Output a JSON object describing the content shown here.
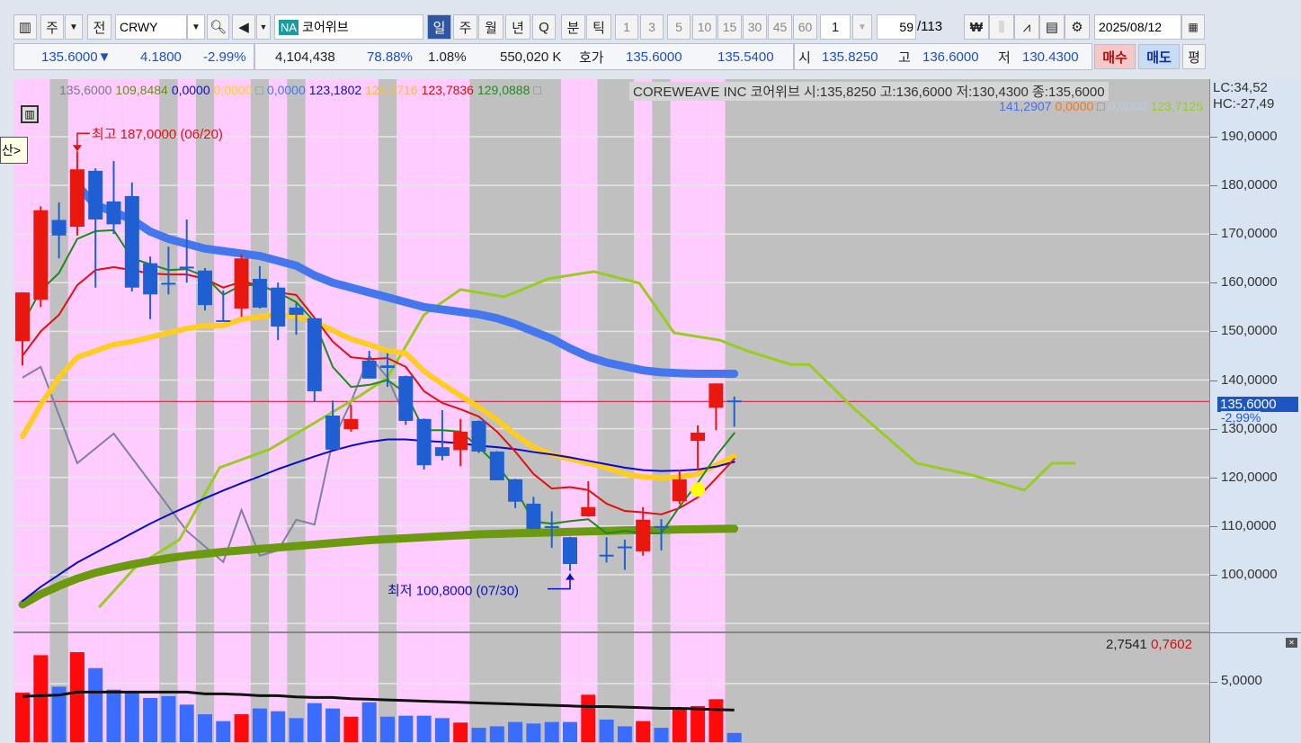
{
  "toolbar": {
    "market": "주",
    "market_all": "전",
    "symbol": "CRWY",
    "name_badge": "NA",
    "name": "코어위브",
    "periods": [
      "일",
      "주",
      "월",
      "년",
      "Q",
      "분",
      "틱"
    ],
    "selected_period": "일",
    "intervals": [
      "1",
      "3",
      "5",
      "10",
      "15",
      "30",
      "45",
      "60"
    ],
    "interval_custom": "1",
    "count": "59",
    "count_total": "/113",
    "date": "2025/08/12",
    "icons": [
      "currency-won-icon",
      "add-candle-icon",
      "add-line-icon",
      "save-icon",
      "gear-icon"
    ]
  },
  "quote": {
    "price": "135.6000▼",
    "change": "4.1800",
    "change_pct": "-2.99%",
    "volume": "4,104,438",
    "ratio": "78.88%",
    "turnover": "1.08%",
    "amount": "550,020 K",
    "hoga_label": "호가",
    "ask": "135.6000",
    "bid": "135.5400",
    "open_label": "시",
    "open": "135.8250",
    "high_label": "고",
    "high": "136.6000",
    "low_label": "저",
    "low": "130.4300",
    "buy": "매수",
    "sell": "매도",
    "avg": "평"
  },
  "legend": {
    "row1": [
      {
        "t": "135,6000",
        "c": "#7a7a90"
      },
      {
        "t": "109,8484",
        "c": "#6b8e23"
      },
      {
        "t": "0,0000",
        "c": "#1010b0"
      },
      {
        "t": "0,0000",
        "c": "#ffd21e"
      },
      {
        "t": "□",
        "c": "#888"
      },
      {
        "t": "0,0000",
        "c": "#4477ee"
      },
      {
        "t": "123,1802",
        "c": "#1010b0"
      },
      {
        "t": "124,3716",
        "c": "#ffb84d"
      },
      {
        "t": "123,7836",
        "c": "#d01010"
      },
      {
        "t": "129,0888",
        "c": "#228822"
      },
      {
        "t": "□",
        "c": "#888"
      }
    ],
    "title": "COREWEAVE INC  코어위브 시:135,8250 고:136,6000 저:130,4300 종:135,6000",
    "row2": [
      {
        "t": "141,2907",
        "c": "#4a72e0"
      },
      {
        "t": "0,0000",
        "c": "#ee7722"
      },
      {
        "t": "□",
        "c": "#888"
      },
      {
        "t": "0,0000",
        "c": "#b8cce8"
      },
      {
        "t": "123,7125",
        "c": "#99cc33"
      }
    ],
    "lc": "LC:34,52",
    "hc": "HC:-27,49",
    "tooltip": "산>",
    "volume_ma": "2,7541",
    "volume_last": "0,7602"
  },
  "axis": {
    "price_labels": [
      "190,0000",
      "180,0000",
      "170,0000",
      "160,0000",
      "150,0000",
      "140,0000",
      "130,0000",
      "120,0000",
      "110,0000",
      "100,0000"
    ],
    "current_price": "135,6000",
    "current_pct": "-2,99%",
    "volume_labels": [
      "5,0000"
    ]
  },
  "chart_data": {
    "type": "candlestick",
    "title": "COREWEAVE INC 코어위브",
    "ylim": [
      88,
      201
    ],
    "annotations": {
      "high": "최고 187,0000 (06/20)",
      "low": "최저 100,8000 (07/30)",
      "high_index": 4,
      "low_index": 31,
      "high_value": 187,
      "low_value": 100.8
    },
    "current_price": 135.6,
    "gray_bars": [
      3,
      9,
      11,
      14,
      16,
      21,
      26,
      27,
      28,
      29,
      30,
      33,
      34,
      36,
      40
    ],
    "ohlc": [
      [
        148,
        158,
        143,
        158
      ],
      [
        156.5,
        175.7,
        155,
        174.9
      ],
      [
        172.9,
        176.5,
        165,
        169.7
      ],
      [
        171.5,
        187,
        169.7,
        183.3
      ],
      [
        183,
        183.5,
        159,
        173
      ],
      [
        176.7,
        185,
        170,
        172
      ],
      [
        177.8,
        180.6,
        158.2,
        159
      ],
      [
        164,
        165.4,
        152.5,
        157.6
      ],
      [
        160,
        167.4,
        157.6,
        159.6
      ],
      [
        163.3,
        173,
        160,
        163
      ],
      [
        162.5,
        163,
        154.3,
        155.4
      ],
      [
        152.3,
        158.4,
        152.1,
        152.2
      ],
      [
        154.7,
        165.8,
        153,
        165
      ],
      [
        160.8,
        163.4,
        154.7,
        154.9
      ],
      [
        159,
        160,
        148.2,
        151
      ],
      [
        154.9,
        155.8,
        149.3,
        153.4
      ],
      [
        152.7,
        152.9,
        135.5,
        137.7
      ],
      [
        132.7,
        135.8,
        125.7,
        125.7
      ],
      [
        129.9,
        134.9,
        129.4,
        132
      ],
      [
        144,
        146,
        140.3,
        140.3
      ],
      [
        143,
        145.5,
        138.6,
        142.5
      ],
      [
        140.8,
        140.9,
        130.8,
        131.6
      ],
      [
        132,
        132.1,
        121.6,
        122.5
      ],
      [
        126.2,
        133.8,
        123.5,
        124.4
      ],
      [
        125.6,
        132,
        122.3,
        129.4
      ],
      [
        131.6,
        131.7,
        125,
        125.3
      ],
      [
        125.3,
        125.4,
        119.4,
        119.4
      ],
      [
        119.6,
        119.7,
        113.7,
        115
      ],
      [
        114.6,
        116,
        109.4,
        109.4
      ],
      [
        110,
        113,
        105.5,
        109.6
      ],
      [
        107.7,
        107.8,
        100.8,
        102.2
      ],
      [
        112,
        119.2,
        111.9,
        113.9
      ],
      [
        104.1,
        107.7,
        102.5,
        104
      ],
      [
        105.8,
        107.2,
        101,
        105.6
      ],
      [
        104.8,
        113.9,
        103.9,
        111.3
      ],
      [
        110,
        111.4,
        105,
        109.6
      ],
      [
        115.1,
        121.6,
        114.5,
        119.6
      ],
      [
        127.5,
        130.7,
        121.4,
        129.2
      ],
      [
        134.3,
        139.3,
        129.7,
        139.3
      ],
      [
        135.8,
        136.6,
        130.4,
        135.6
      ]
    ],
    "volume": [
      4.1,
      7.21,
      4.6,
      7.46,
      6.14,
      4.35,
      4.1,
      3.66,
      3.81,
      3.11,
      2.31,
      1.74,
      2.31,
      2.79,
      2.56,
      1.99,
      3.23,
      2.79,
      2.11,
      3.31,
      2.11,
      2.19,
      2.19,
      1.99,
      1.62,
      1.19,
      1.31,
      1.67,
      1.54,
      1.67,
      1.67,
      3.93,
      1.87,
      1.31,
      1.74,
      1.19,
      2.81,
      2.99,
      3.56,
      0.76
    ],
    "volume_ma": [
      3.8,
      3.85,
      3.9,
      4.15,
      4.15,
      4.15,
      4.15,
      4.15,
      4.15,
      4.15,
      4.0,
      4.0,
      3.95,
      3.85,
      3.85,
      3.75,
      3.7,
      3.7,
      3.6,
      3.55,
      3.5,
      3.45,
      3.4,
      3.35,
      3.3,
      3.25,
      3.2,
      3.15,
      3.1,
      3.05,
      3.0,
      2.95,
      2.95,
      2.9,
      2.85,
      2.8,
      2.8,
      2.75,
      2.7,
      2.66
    ],
    "series": [
      {
        "name": "ma_long_blue",
        "color": "#4477ee",
        "width": 9,
        "start": 4,
        "values": [
          180,
          176,
          174.5,
          173,
          170.5,
          169,
          168,
          167,
          166.5,
          166,
          165.5,
          164.5,
          163.5,
          161.5,
          160,
          159,
          158,
          157,
          156,
          155,
          154.5,
          154,
          153.5,
          152.7,
          151.5,
          150,
          148.5,
          146.5,
          144.8,
          143.6,
          142.8,
          142,
          141.6,
          141.4,
          141.3,
          141.3,
          141.3
        ]
      },
      {
        "name": "ma_olive",
        "color": "#6b9a10",
        "width": 9,
        "start": 1,
        "values": [
          93.9,
          96,
          97.7,
          99.2,
          100.4,
          101.3,
          102.1,
          102.8,
          103.4,
          103.9,
          104.3,
          104.7,
          105,
          105.3,
          105.6,
          105.9,
          106.2,
          106.5,
          106.8,
          107.1,
          107.3,
          107.5,
          107.7,
          107.9,
          108.1,
          108.3,
          108.4,
          108.5,
          108.6,
          108.7,
          108.8,
          108.9,
          109,
          109.1,
          109.15,
          109.2,
          109.3,
          109.35,
          109.4,
          109.45
        ]
      },
      {
        "name": "ma_yellow",
        "color": "#ffcc22",
        "width": 6,
        "start": 1,
        "values": [
          128.4,
          134.9,
          140.5,
          144.7,
          146,
          147.3,
          147.9,
          148.8,
          149.7,
          150.6,
          151.2,
          151.2,
          152.5,
          153,
          153.4,
          153,
          152,
          150.2,
          148.4,
          147.3,
          146,
          145.5,
          141.8,
          139.2,
          136.8,
          134.4,
          131.8,
          128.8,
          126.2,
          124.7,
          123.8,
          122.9,
          122,
          120.7,
          120.1,
          119.8,
          120.1,
          120.7,
          122.5,
          124.37
        ]
      },
      {
        "name": "ma_navy",
        "color": "#0a0ac8",
        "width": 2,
        "start": 1,
        "values": [
          94.6,
          97.5,
          100,
          102.5,
          104.5,
          106.5,
          108.5,
          110.5,
          112.3,
          114,
          115.7,
          117.3,
          118.8,
          120.2,
          121.7,
          123,
          124.3,
          125.5,
          126.5,
          127.3,
          127.8,
          127.8,
          127.5,
          127.3,
          127,
          126.5,
          126.2,
          125.8,
          125.2,
          124.7,
          124.1,
          123.4,
          122.7,
          122,
          121.5,
          121.3,
          121.4,
          121.6,
          122.2,
          123.18
        ]
      },
      {
        "name": "ma_red",
        "color": "#e01010",
        "width": 2,
        "start": 1,
        "values": [
          145,
          150,
          153.4,
          159.5,
          162.6,
          163.2,
          162.6,
          161.9,
          161.7,
          161.7,
          160.8,
          159,
          160.2,
          159.5,
          158,
          157.5,
          152.8,
          147.9,
          144.7,
          144.3,
          144.5,
          142.7,
          137.7,
          135.3,
          134,
          132.5,
          129.4,
          125.3,
          120.7,
          117.7,
          118,
          117.4,
          114.6,
          113.1,
          112.8,
          112.4,
          113.7,
          115.9,
          119.8,
          123.78
        ]
      },
      {
        "name": "ma_green",
        "color": "#1e8a1e",
        "width": 2,
        "start": 1,
        "values": [
          151.6,
          158.4,
          162,
          169,
          170.6,
          170.8,
          165,
          163.8,
          162.6,
          162.8,
          161.3,
          157.5,
          159.5,
          159.5,
          158,
          156,
          152,
          142.7,
          138.6,
          139,
          140,
          137.3,
          129.7,
          129.7,
          129.4,
          126.2,
          122.5,
          117.7,
          110.9,
          110.5,
          111,
          111.4,
          108.5,
          109,
          108.5,
          108.5,
          114,
          118.9,
          124.4,
          129.09
        ]
      }
    ],
    "leading_span": {
      "color": "#99cc22",
      "points": [
        [
          5.2,
          93.3
        ],
        [
          7.2,
          101.6
        ],
        [
          9.6,
          107.2
        ],
        [
          11.8,
          122
        ],
        [
          14.5,
          125.7
        ],
        [
          17,
          131.2
        ],
        [
          19.5,
          136.8
        ],
        [
          21,
          140.5
        ],
        [
          23,
          153.4
        ],
        [
          25,
          158.6
        ],
        [
          27.4,
          157.1
        ],
        [
          29.8,
          160.8
        ],
        [
          32.3,
          162.3
        ],
        [
          34.8,
          159.9
        ],
        [
          36.7,
          149.7
        ],
        [
          39.2,
          148.2
        ],
        [
          40.7,
          146
        ],
        [
          43.1,
          143.2
        ],
        [
          44.1,
          143.2
        ],
        [
          46.6,
          134
        ],
        [
          50,
          122.9
        ],
        [
          53,
          120.5
        ],
        [
          55.9,
          117.4
        ],
        [
          57.4,
          122.9
        ],
        [
          58.7,
          122.9
        ]
      ]
    },
    "lagging_span": {
      "color": "#8080a0",
      "points": [
        [
          1,
          140.5
        ],
        [
          2,
          142.7
        ],
        [
          4,
          122.9
        ],
        [
          6,
          129
        ],
        [
          10,
          109
        ],
        [
          12,
          102.6
        ],
        [
          13,
          113.3
        ],
        [
          14,
          103.9
        ],
        [
          15,
          105
        ],
        [
          16,
          111.3
        ],
        [
          17,
          110.3
        ],
        [
          18,
          127.5
        ],
        [
          19,
          135.5
        ],
        [
          20,
          145
        ],
        [
          21,
          140.5
        ],
        [
          22,
          132.1
        ]
      ]
    },
    "signal_dot": {
      "index": 38,
      "value": 117.5,
      "color": "#ffff00"
    }
  }
}
